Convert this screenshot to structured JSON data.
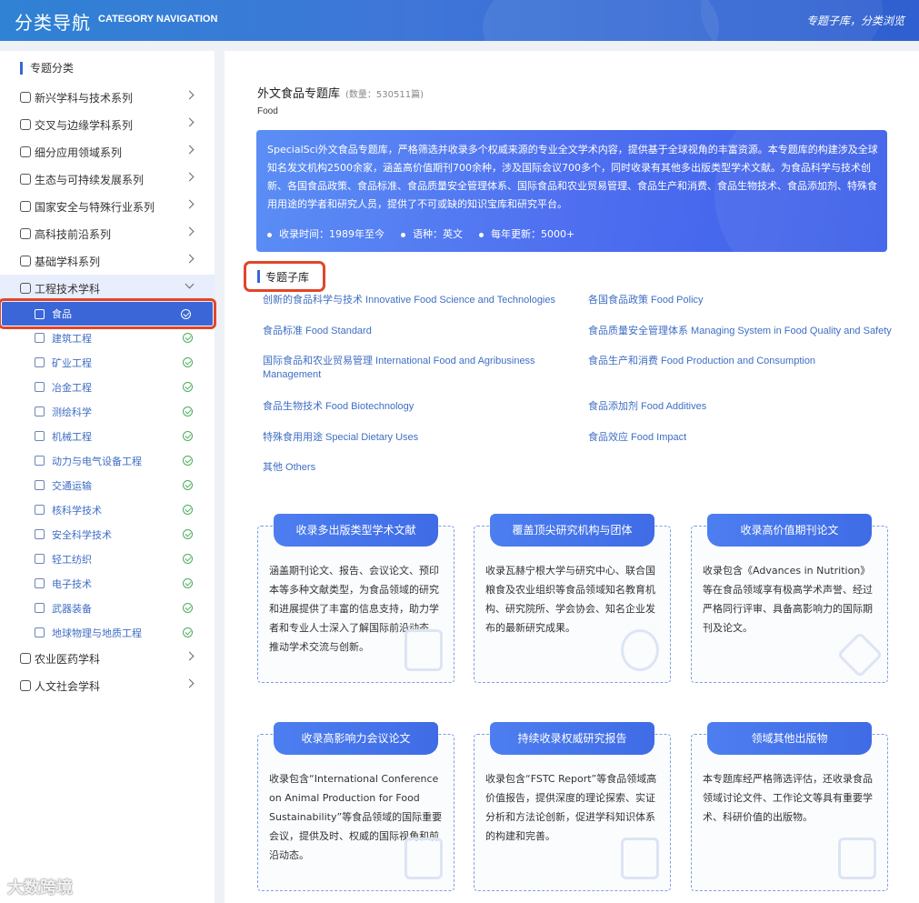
{
  "header": {
    "title": "分类导航",
    "title_en": "CATEGORY NAVIGATION",
    "right_text": "专题子库，分类浏览"
  },
  "sidebar": {
    "heading": "专题分类",
    "categories": [
      {
        "label": "新兴学科与技术系列",
        "icon": "grid-icon"
      },
      {
        "label": "交叉与边缘学科系列",
        "icon": "shuffle-icon"
      },
      {
        "label": "细分应用领域系列",
        "icon": "apps-icon"
      },
      {
        "label": "生态与可持续发展系列",
        "icon": "globe-icon"
      },
      {
        "label": "国家安全与特殊行业系列",
        "icon": "shield-icon"
      },
      {
        "label": "高科技前沿系列",
        "icon": "gear-icon"
      },
      {
        "label": "基础学科系列",
        "icon": "compass-icon"
      },
      {
        "label": "工程技术学科",
        "icon": "cube-icon"
      }
    ],
    "sub_items": [
      {
        "label": "食品",
        "icon": "play-icon"
      },
      {
        "label": "建筑工程",
        "icon": "crane-icon"
      },
      {
        "label": "矿业工程",
        "icon": "mine-icon"
      },
      {
        "label": "冶金工程",
        "icon": "anvil-icon"
      },
      {
        "label": "测绘科学",
        "icon": "survey-icon"
      },
      {
        "label": "机械工程",
        "icon": "wrench-icon"
      },
      {
        "label": "动力与电气设备工程",
        "icon": "plug-icon"
      },
      {
        "label": "交通运输",
        "icon": "truck-icon"
      },
      {
        "label": "核科学技术",
        "icon": "atom-icon"
      },
      {
        "label": "安全科学技术",
        "icon": "warning-icon"
      },
      {
        "label": "轻工纺织",
        "icon": "textile-icon"
      },
      {
        "label": "电子技术",
        "icon": "circuit-icon"
      },
      {
        "label": "武器装备",
        "icon": "tank-icon"
      },
      {
        "label": "地球物理与地质工程",
        "icon": "earth-icon"
      }
    ],
    "bottom_categories": [
      {
        "label": "农业医药学科",
        "icon": "leaf-icon"
      },
      {
        "label": "人文社会学科",
        "icon": "book-icon"
      }
    ]
  },
  "main": {
    "title": "外文食品专题库",
    "count": "(数量：530511篇)",
    "title_en": "Food",
    "banner": {
      "description": "SpecialSci外文食品专题库，严格筛选并收录多个权威来源的专业全文学术内容，提供基于全球视角的丰富资源。本专题库的构建涉及全球知名发文机构2500余家，涵盖高价值期刊700余种，涉及国际会议700多个，同时收录有其他多出版类型学术文献。为食品科学与技术创新、各国食品政策、食品标准、食品质量安全管理体系、国际食品和农业贸易管理、食品生产和消费、食品生物技术、食品添加剂、特殊食用用途的学者和研究人员，提供了不可或缺的知识宝库和研究平台。",
      "meta": [
        "收录时间：1989年至今",
        "语种：英文",
        "每年更新：5000+"
      ]
    },
    "sub_db_heading": "专题子库",
    "sub_dbs": [
      "创新的食品科学与技术 Innovative Food Science and Technologies",
      "各国食品政策 Food Policy",
      "食品标准 Food Standard",
      "食品质量安全管理体系 Managing System in Food Quality and Safety",
      "国际食品和农业贸易管理 International Food and Agribusiness Management",
      "食品生产和消费 Food Production and Consumption",
      "食品生物技术 Food Biotechnology",
      "食品添加剂 Food Additives",
      "特殊食用用途 Special Dietary Uses",
      "食品效应 Food Impact",
      "其他 Others"
    ],
    "cards": [
      {
        "title": "收录多出版类型学术文献",
        "body": "涵盖期刊论文、报告、会议论文、预印本等多种文献类型，为食品领域的研究和进展提供了丰富的信息支持，助力学者和专业人士深入了解国际前沿动态、推动学术交流与创新。",
        "icon": "document-icon"
      },
      {
        "title": "覆盖顶尖研究机构与团体",
        "body": "收录瓦赫宁根大学与研究中心、联合国粮食及农业组织等食品领域知名教育机构、研究院所、学会协会、知名企业发布的最新研究成果。",
        "icon": "users-icon"
      },
      {
        "title": "收录高价值期刊论文",
        "body": "收录包含《Advances in Nutrition》等在食品领域享有极高学术声誉、经过严格同行评审、具备高影响力的国际期刊及论文。",
        "icon": "network-icon"
      },
      {
        "title": "收录高影响力会议论文",
        "body": "收录包含“International Conference on Animal Production for Food Sustainability”等食品领域的国际重要会议，提供及时、权威的国际视角和前沿动态。",
        "icon": "presentation-icon"
      },
      {
        "title": "持续收录权威研究报告",
        "body": "收录包含“FSTC Report”等食品领域高价值报告，提供深度的理论探索、实证分析和方法论创新，促进学科知识体系的构建和完善。",
        "icon": "report-icon"
      },
      {
        "title": "领域其他出版物",
        "body": "本专题库经严格筛选评估，还收录食品领域讨论文件、工作论文等具有重要学术、科研价值的出版物。",
        "icon": "book-icon"
      }
    ]
  },
  "watermark": "大数跨境"
}
